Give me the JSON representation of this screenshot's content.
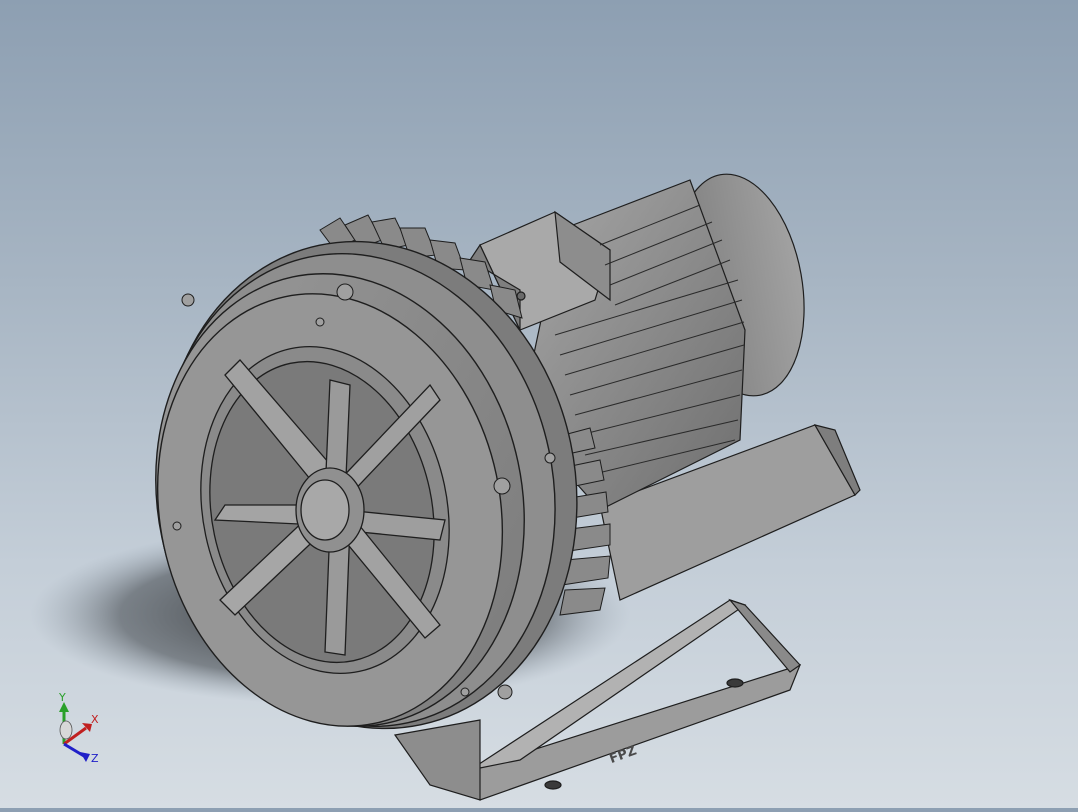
{
  "viewport": {
    "background_top": "#8d9fb2",
    "background_bottom": "#d6dde3"
  },
  "model": {
    "brand_plate": "FPZ",
    "body_color": "#8c8c8c",
    "edge_color": "#1e1e1e"
  },
  "triad": {
    "x_label": "X",
    "y_label": "Y",
    "z_label": "Z",
    "x_color": "#c02020",
    "y_color": "#2aa02a",
    "z_color": "#2020c8"
  }
}
